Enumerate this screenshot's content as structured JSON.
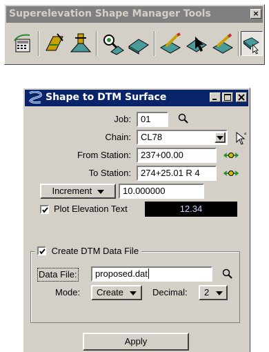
{
  "toolbar": {
    "title": "Superelevation Shape Manager Tools",
    "close_glyph": "×",
    "tools": [
      {
        "name": "calculator-icon"
      },
      {
        "name": "rule-edit-icon"
      },
      {
        "name": "shape-builder-icon"
      },
      {
        "name": "inspect-shape-icon"
      },
      {
        "name": "shape-surface-icon"
      },
      {
        "name": "shape-draw-icon"
      },
      {
        "name": "shape-select-icon"
      },
      {
        "name": "shape-modify-icon"
      },
      {
        "name": "shape-to-dtm-icon"
      }
    ]
  },
  "dialog": {
    "title": "Shape to DTM Surface",
    "job": {
      "label": "Job:",
      "value": "01"
    },
    "chain": {
      "label": "Chain:",
      "value": "CL78"
    },
    "from_station": {
      "label": "From Station:",
      "value": "237+00.00"
    },
    "to_station": {
      "label": "To Station:",
      "value": "274+25.01 R 4"
    },
    "increment": {
      "label": "Increment",
      "value": "10.000000"
    },
    "plot_elevation": {
      "label": "Plot Elevation Text",
      "checked": true,
      "value": "12.34"
    },
    "dtm_group": {
      "label": "Create DTM Data File",
      "checked": true,
      "data_file": {
        "label": "Data File:",
        "value": "proposed.dat"
      },
      "mode": {
        "label": "Mode:",
        "value": "Create"
      },
      "decimal": {
        "label": "Decimal:",
        "value": "2"
      }
    },
    "apply_label": "Apply"
  }
}
